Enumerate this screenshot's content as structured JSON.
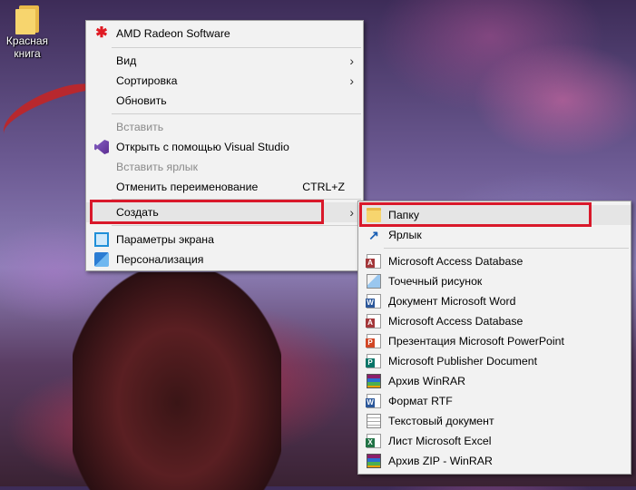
{
  "desktop": {
    "icon_label": "Красная книга"
  },
  "context_menu": {
    "items": [
      {
        "label": "AMD Radeon Software",
        "icon": "amd-icon"
      },
      {
        "label": "Вид",
        "submenu": true
      },
      {
        "label": "Сортировка",
        "submenu": true
      },
      {
        "label": "Обновить"
      },
      {
        "label": "Вставить",
        "disabled": true
      },
      {
        "label": "Открыть с помощью Visual Studio",
        "icon": "visual-studio-icon"
      },
      {
        "label": "Вставить ярлык",
        "disabled": true
      },
      {
        "label": "Отменить переименование",
        "shortcut": "CTRL+Z"
      },
      {
        "label": "Создать",
        "submenu": true
      },
      {
        "label": "Параметры экрана",
        "icon": "display-settings-icon"
      },
      {
        "label": "Персонализация",
        "icon": "personalization-icon"
      }
    ]
  },
  "create_submenu": {
    "items": [
      {
        "label": "Папку",
        "icon": "folder-icon"
      },
      {
        "label": "Ярлык",
        "icon": "shortcut-icon"
      },
      {
        "label": "Microsoft Access Database",
        "icon": "access-icon"
      },
      {
        "label": "Точечный рисунок",
        "icon": "bitmap-icon"
      },
      {
        "label": "Документ Microsoft Word",
        "icon": "word-icon"
      },
      {
        "label": "Microsoft Access Database",
        "icon": "access-icon"
      },
      {
        "label": "Презентация Microsoft PowerPoint",
        "icon": "powerpoint-icon"
      },
      {
        "label": "Microsoft Publisher Document",
        "icon": "publisher-icon"
      },
      {
        "label": "Архив WinRAR",
        "icon": "winrar-icon"
      },
      {
        "label": "Формат RTF",
        "icon": "rtf-icon"
      },
      {
        "label": "Текстовый документ",
        "icon": "text-document-icon"
      },
      {
        "label": "Лист Microsoft Excel",
        "icon": "excel-icon"
      },
      {
        "label": "Архив ZIP - WinRAR",
        "icon": "winrar-zip-icon"
      }
    ]
  },
  "colors": {
    "highlight_border": "#d9182a",
    "menu_background": "#f2f2f2"
  }
}
